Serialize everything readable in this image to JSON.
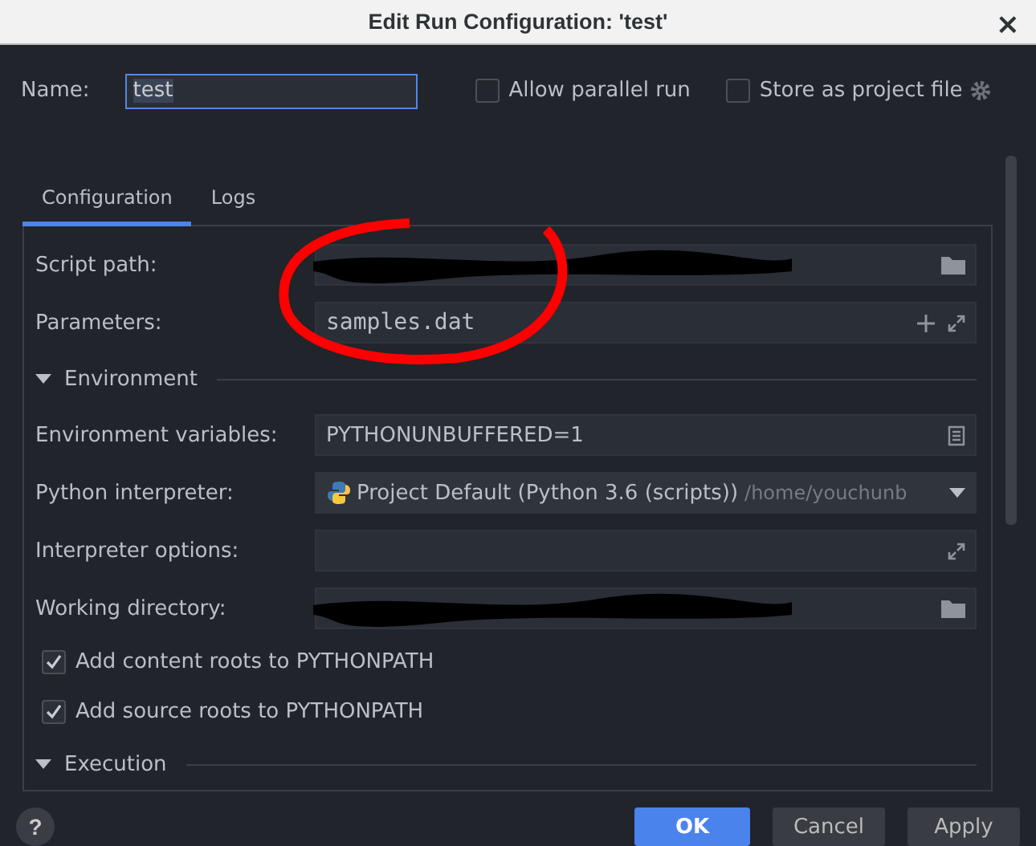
{
  "window": {
    "title": "Edit Run Configuration: 'test'",
    "close": "×"
  },
  "name": {
    "label": "Name:",
    "value": "test"
  },
  "options": [
    {
      "label": "Allow parallel run",
      "checked": false
    },
    {
      "label": "Store as project file",
      "checked": false
    }
  ],
  "tabs": [
    {
      "label": "Configuration",
      "selected": true
    },
    {
      "label": "Logs",
      "selected": false
    }
  ],
  "rows": [
    {
      "kind": "path",
      "label": "Script path:",
      "redacted": true
    },
    {
      "kind": "params",
      "label": "Parameters:",
      "value": "samples.dat"
    },
    {
      "kind": "section",
      "label": "Environment",
      "expanded": true
    },
    {
      "kind": "text",
      "label": "Environment variables:",
      "value": "PYTHONUNBUFFERED=1"
    },
    {
      "kind": "interpreter",
      "label": "Python interpreter:",
      "value": "Project Default (Python 3.6 (scripts))",
      "hint": "/home/youchunb"
    },
    {
      "kind": "expand",
      "label": "Interpreter options:"
    },
    {
      "kind": "path",
      "label": "Working directory:",
      "redacted": true
    },
    {
      "kind": "check",
      "label": "Add content roots to PYTHONPATH",
      "checked": true
    },
    {
      "kind": "check",
      "label": "Add source roots to PYTHONPATH",
      "checked": true
    },
    {
      "kind": "section",
      "label": "Execution",
      "expanded": true
    }
  ],
  "buttons": [
    {
      "label": "OK",
      "primary": true
    },
    {
      "label": "Cancel",
      "primary": false
    },
    {
      "label": "Apply",
      "primary": false
    }
  ],
  "help": "?"
}
